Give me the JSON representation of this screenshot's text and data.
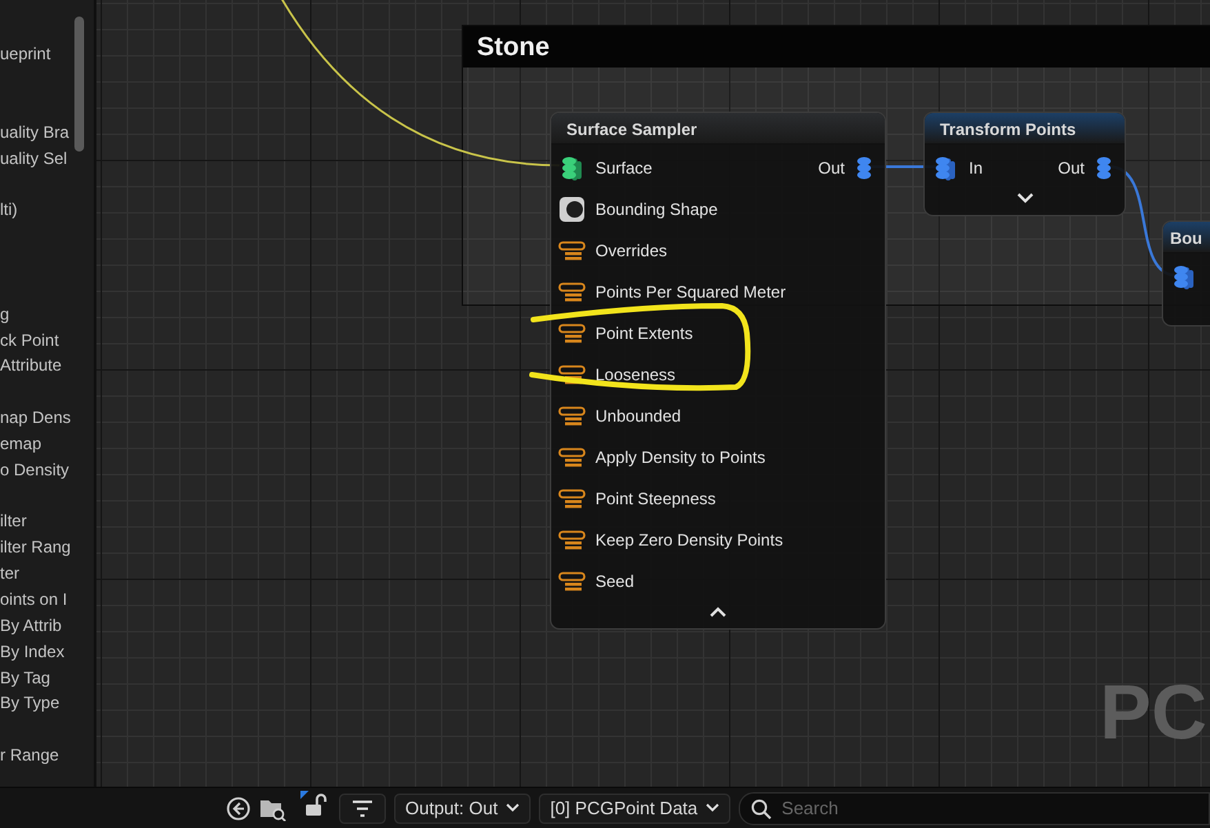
{
  "sidebar": {
    "items": [
      "ueprint",
      "uality Bra",
      "uality Sel",
      "lti)",
      "g",
      "ck Point",
      "Attribute",
      "nap Dens",
      "emap",
      "o Density",
      "ilter",
      "ilter Rang",
      "ter",
      "oints on I",
      "By Attrib",
      "By Index",
      "By Tag",
      "By Type",
      "r Range"
    ]
  },
  "comment": {
    "title": "Stone"
  },
  "nodes": [
    {
      "title": "Surface Sampler",
      "color": "#2b2d30",
      "expanded": true,
      "inputs": [
        {
          "label": "Surface",
          "kind": "surface"
        },
        {
          "label": "Bounding Shape",
          "kind": "shape"
        },
        {
          "label": "Overrides",
          "kind": "param"
        },
        {
          "label": "Points Per Squared Meter",
          "kind": "param"
        },
        {
          "label": "Point Extents",
          "kind": "param"
        },
        {
          "label": "Looseness",
          "kind": "param"
        },
        {
          "label": "Unbounded",
          "kind": "param"
        },
        {
          "label": "Apply Density to Points",
          "kind": "param"
        },
        {
          "label": "Point Steepness",
          "kind": "param"
        },
        {
          "label": "Keep Zero Density Points",
          "kind": "param"
        },
        {
          "label": "Seed",
          "kind": "param"
        }
      ],
      "outputs": [
        {
          "label": "Out",
          "kind": "point"
        }
      ]
    },
    {
      "title": "Transform Points",
      "color": "#1c3f66",
      "expanded": false,
      "inputs": [
        {
          "label": "In",
          "kind": "point"
        }
      ],
      "outputs": [
        {
          "label": "Out",
          "kind": "point"
        }
      ]
    },
    {
      "title": "Bou",
      "color": "#1c3f66",
      "inputs": [
        {
          "kind": "point"
        }
      ]
    }
  ],
  "graph_type_label": "PC",
  "toolbar": {
    "output_dropdown": "Output: Out",
    "data_dropdown": "[0] PCGPoint Data",
    "search": {
      "placeholder": "Search"
    }
  }
}
